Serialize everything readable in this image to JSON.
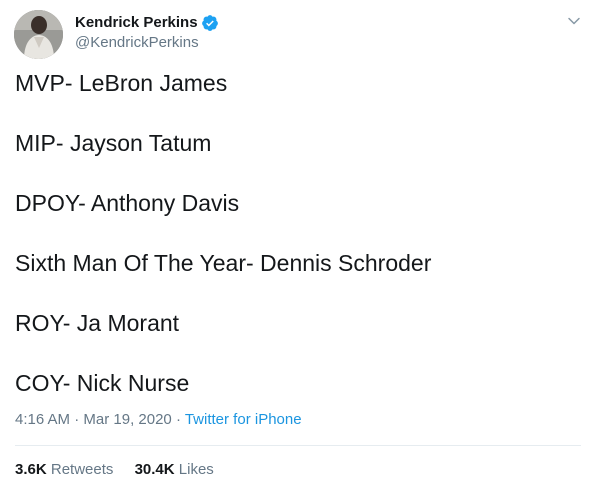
{
  "user": {
    "display_name": "Kendrick Perkins",
    "handle": "@KendrickPerkins",
    "verified_icon": "verified-badge-icon"
  },
  "tweet": {
    "lines": [
      "MVP- LeBron James",
      "MIP- Jayson Tatum",
      "DPOY- Anthony Davis",
      "Sixth Man Of The Year- Dennis Schroder",
      "ROY- Ja Morant",
      "COY- Nick Nurse"
    ],
    "time": "4:16 AM",
    "sep1": " · ",
    "date": "Mar 19, 2020",
    "sep2": " · ",
    "source": "Twitter for iPhone"
  },
  "stats": {
    "retweets_count": "3.6K",
    "retweets_label": "Retweets",
    "likes_count": "30.4K",
    "likes_label": "Likes"
  },
  "colors": {
    "text": "#14171a",
    "secondary": "#657786",
    "link": "#1b95e0",
    "verified": "#1da1f2"
  }
}
